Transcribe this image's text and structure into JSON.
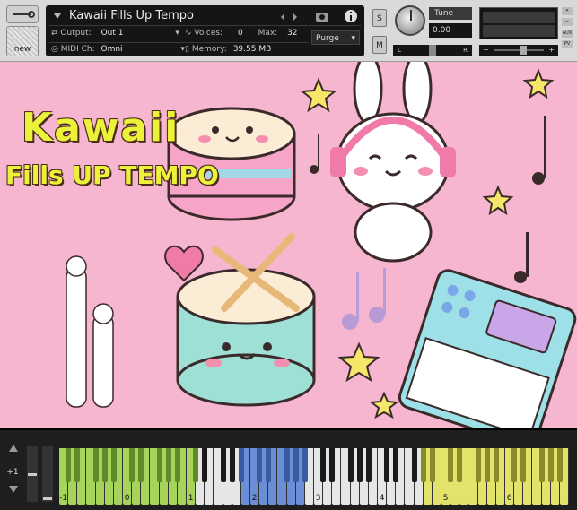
{
  "header": {
    "instrument_title": "Kawaii Fills Up Tempo",
    "output_label": "Output:",
    "output_value": "Out 1",
    "voices_label": "Voices:",
    "voices_value": "0",
    "max_label": "Max:",
    "max_value": "32",
    "purge_label": "Purge",
    "midi_label": "MIDI Ch:",
    "midi_value": "Omni",
    "memory_label": "Memory:",
    "memory_value": "39.55 MB",
    "solo_label": "S",
    "mute_label": "M",
    "tune_label": "Tune",
    "tune_value": "0.00",
    "new_label": "new",
    "pan_left": "L",
    "pan_right": "R",
    "aux_label": "AUX",
    "pv_label": "PV"
  },
  "artwork": {
    "title_line1": "Kawaii",
    "title_line2": "Fills UP TEMPO"
  },
  "keyboard": {
    "octave_shift": "+1",
    "octave_labels": [
      "-1",
      "0",
      "1",
      "2",
      "3",
      "4",
      "5",
      "6"
    ],
    "colors": {
      "green": "#a6d45a",
      "white": "#e6e6e6",
      "blue": "#6b8fd6",
      "yellow": "#e2e36a"
    }
  }
}
